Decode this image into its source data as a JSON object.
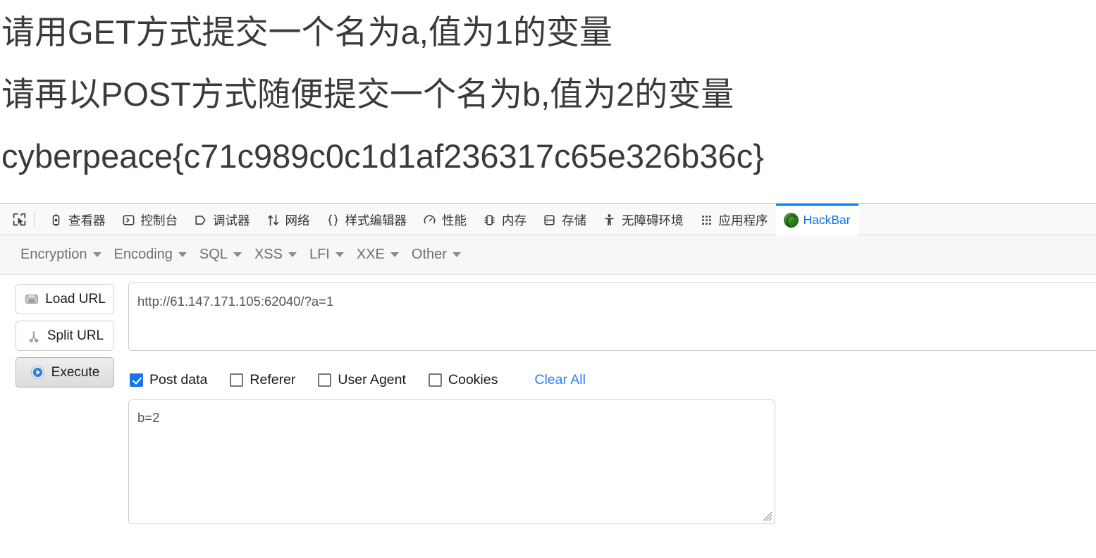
{
  "page": {
    "lines": [
      "请用GET方式提交一个名为a,值为1的变量",
      "请再以POST方式随便提交一个名为b,值为2的变量",
      "cyberpeace{c71c989c0c1d1af236317c65e326b36c}"
    ]
  },
  "devtools": {
    "picker_icon": "element-picker-icon",
    "tabs": [
      {
        "label": "查看器",
        "icon": "inspector-icon",
        "active": false
      },
      {
        "label": "控制台",
        "icon": "console-icon",
        "active": false
      },
      {
        "label": "调试器",
        "icon": "debugger-icon",
        "active": false
      },
      {
        "label": "网络",
        "icon": "network-icon",
        "active": false
      },
      {
        "label": "样式编辑器",
        "icon": "style-editor-icon",
        "active": false
      },
      {
        "label": "性能",
        "icon": "performance-icon",
        "active": false
      },
      {
        "label": "内存",
        "icon": "memory-icon",
        "active": false
      },
      {
        "label": "存储",
        "icon": "storage-icon",
        "active": false
      },
      {
        "label": "无障碍环境",
        "icon": "accessibility-icon",
        "active": false
      },
      {
        "label": "应用程序",
        "icon": "application-icon",
        "active": false
      },
      {
        "label": "HackBar",
        "icon": "hackbar-globe-icon",
        "active": true
      }
    ],
    "active_tab_accent": "#0a84ff"
  },
  "hackbar": {
    "menus": [
      {
        "label": "Encryption"
      },
      {
        "label": "Encoding"
      },
      {
        "label": "SQL"
      },
      {
        "label": "XSS"
      },
      {
        "label": "LFI"
      },
      {
        "label": "XXE"
      },
      {
        "label": "Other"
      }
    ],
    "buttons": [
      {
        "label": "Load URL",
        "icon": "disk-drive-icon",
        "pressed": false
      },
      {
        "label": "Split URL",
        "icon": "scissors-icon",
        "pressed": false
      },
      {
        "label": "Execute",
        "icon": "play-circle-icon",
        "pressed": true
      }
    ],
    "url": {
      "value": "http://61.147.171.105:62040/?a=1",
      "placeholder": "URL"
    },
    "options": [
      {
        "label": "Post data",
        "checked": true
      },
      {
        "label": "Referer",
        "checked": false
      },
      {
        "label": "User Agent",
        "checked": false
      },
      {
        "label": "Cookies",
        "checked": false
      }
    ],
    "clear_all_label": "Clear All",
    "post_data": {
      "value": "b=2",
      "placeholder": "Post data"
    },
    "link_color": "#2d7ff9",
    "checked_color": "#1a73e8"
  }
}
